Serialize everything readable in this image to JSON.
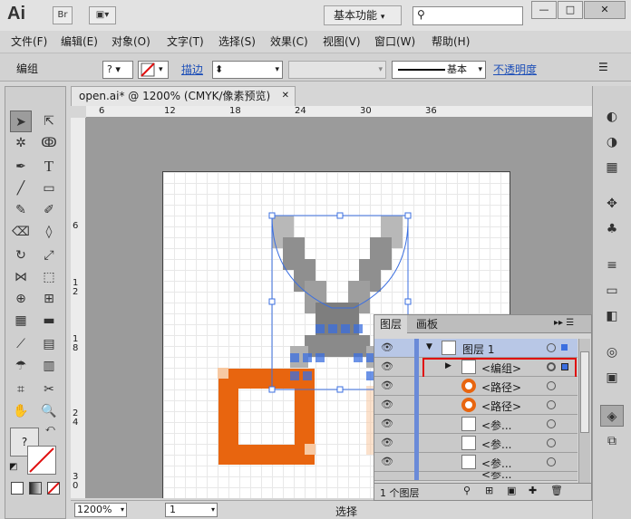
{
  "app": {
    "logo": "Ai",
    "bridge": "Br",
    "arrange": "▣▾",
    "workspace": "基本功能",
    "workspace_arrow": "▾",
    "search_icon": "⚲"
  },
  "window_controls": {
    "minimize": "—",
    "maximize": "□",
    "close": "✕"
  },
  "menu": [
    "文件(F)",
    "编辑(E)",
    "对象(O)",
    "文字(T)",
    "选择(S)",
    "效果(C)",
    "视图(V)",
    "窗口(W)",
    "帮助(H)"
  ],
  "control": {
    "selection": "编组",
    "fill_value": "?",
    "stroke_label": "描边",
    "stroke_unit": "⬍",
    "brush": "基本",
    "opacity_label": "不透明度",
    "panel_menu": "☰"
  },
  "document": {
    "tab": "open.ai* @ 1200% (CMYK/像素预览)",
    "tab_close": "✕"
  },
  "ruler": {
    "h": [
      "6",
      "12",
      "18",
      "24",
      "30",
      "36"
    ],
    "v": [
      "6",
      "1 2",
      "1 8",
      "2 4",
      "3 0"
    ]
  },
  "status": {
    "zoom": "1200%",
    "page": "1",
    "tool": "选择"
  },
  "layers_panel": {
    "tabs": [
      "图层",
      "画板"
    ],
    "menu": "▸▸ ☰",
    "rows": [
      {
        "label": "图层 1",
        "type": "layer"
      },
      {
        "label": "<编组>",
        "type": "group",
        "highlight": true
      },
      {
        "label": "<路径>",
        "type": "path"
      },
      {
        "label": "<路径>",
        "type": "path"
      },
      {
        "label": "<参...",
        "type": "ref"
      },
      {
        "label": "<参...",
        "type": "ref"
      },
      {
        "label": "<参...",
        "type": "ref"
      },
      {
        "label": "<参...",
        "type": "ref"
      }
    ],
    "footer": "1 个图层",
    "footer_icons": [
      "⚲",
      "⊞",
      "▣",
      "✚",
      "🗑"
    ]
  },
  "colors": {
    "accent": "#e8650f",
    "selection": "#3b6fe0",
    "highlight": "#e01010",
    "layer_blue": "#b8c7e6"
  }
}
